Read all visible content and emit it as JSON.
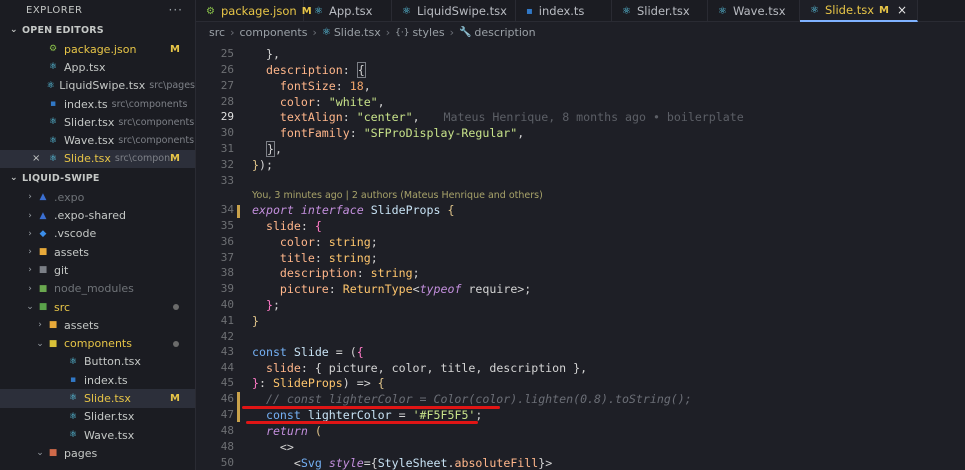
{
  "explorer": {
    "title": "EXPLORER",
    "more": "···",
    "open_editors_header": "OPEN EDITORS",
    "open_editors": [
      {
        "name": "package.json",
        "desc": "",
        "mark": "M",
        "icon": "json-icon",
        "color": "#e7c547"
      },
      {
        "name": "App.tsx",
        "desc": "",
        "mark": "",
        "icon": "react-icon",
        "color": "#c5c8c6"
      },
      {
        "name": "LiquidSwipe.tsx",
        "desc": "src\\pages",
        "mark": "",
        "icon": "react-icon",
        "color": "#c5c8c6"
      },
      {
        "name": "index.ts",
        "desc": "src\\components",
        "mark": "",
        "icon": "typescript-icon",
        "color": "#c5c8c6"
      },
      {
        "name": "Slider.tsx",
        "desc": "src\\components",
        "mark": "",
        "icon": "react-icon",
        "color": "#c5c8c6"
      },
      {
        "name": "Wave.tsx",
        "desc": "src\\components",
        "mark": "",
        "icon": "react-icon",
        "color": "#c5c8c6"
      },
      {
        "name": "Slide.tsx",
        "desc": "src\\compon...",
        "mark": "M",
        "icon": "react-icon",
        "color": "#e7c547",
        "close": "×"
      }
    ],
    "project_header": "LIQUID-SWIPE",
    "tree": [
      {
        "name": ".expo",
        "color": "#6f7378"
      },
      {
        "name": ".expo-shared",
        "color": "#c5c8c6"
      },
      {
        "name": ".vscode",
        "color": "#c5c8c6"
      },
      {
        "name": "assets",
        "color": "#c5c8c6"
      },
      {
        "name": "git",
        "color": "#c5c8c6"
      },
      {
        "name": "node_modules",
        "color": "#6f7378"
      },
      {
        "name": "src",
        "color": "#e7c547"
      },
      {
        "name": "assets",
        "color": "#c5c8c6"
      },
      {
        "name": "components",
        "color": "#e7c547"
      },
      {
        "name": "Button.tsx",
        "color": "#c5c8c6"
      },
      {
        "name": "index.ts",
        "color": "#c5c8c6"
      },
      {
        "name": "Slide.tsx",
        "color": "#e7c547",
        "mark": "M"
      },
      {
        "name": "Slider.tsx",
        "color": "#c5c8c6"
      },
      {
        "name": "Wave.tsx",
        "color": "#c5c8c6"
      },
      {
        "name": "pages",
        "color": "#c5c8c6"
      }
    ]
  },
  "tabs": [
    {
      "label": "package.json",
      "mark": "M",
      "color": "#e7c547",
      "icon": "json-icon"
    },
    {
      "label": "App.tsx",
      "mark": "",
      "color": "#b9bcc2",
      "icon": "react-icon"
    },
    {
      "label": "LiquidSwipe.tsx",
      "mark": "",
      "color": "#b9bcc2",
      "icon": "react-icon"
    },
    {
      "label": "index.ts",
      "mark": "",
      "color": "#b9bcc2",
      "icon": "typescript-icon"
    },
    {
      "label": "Slider.tsx",
      "mark": "",
      "color": "#b9bcc2",
      "icon": "react-icon"
    },
    {
      "label": "Wave.tsx",
      "mark": "",
      "color": "#b9bcc2",
      "icon": "react-icon"
    },
    {
      "label": "Slide.tsx",
      "mark": "M",
      "color": "#e7c547",
      "icon": "react-icon",
      "active": true,
      "close": "×"
    }
  ],
  "breadcrumb": [
    "src",
    "components",
    "Slide.tsx",
    "styles",
    "description"
  ],
  "editor": {
    "line_numbers": [
      "25",
      "26",
      "27",
      "28",
      "29",
      "30",
      "31",
      "32",
      "33",
      "",
      "34",
      "35",
      "36",
      "37",
      "38",
      "39",
      "40",
      "41",
      "42",
      "43",
      "44",
      "45",
      "46",
      "47",
      "47",
      "48",
      "50"
    ],
    "current_line": "29",
    "blame_inline": "Mateus Henrique, 8 months ago • boilerplate",
    "codelens": "You, 3 minutes ago | 2 authors (Mateus Henrique and others)",
    "modified_color": "#c9a24b",
    "underline_color": "#e01515"
  }
}
